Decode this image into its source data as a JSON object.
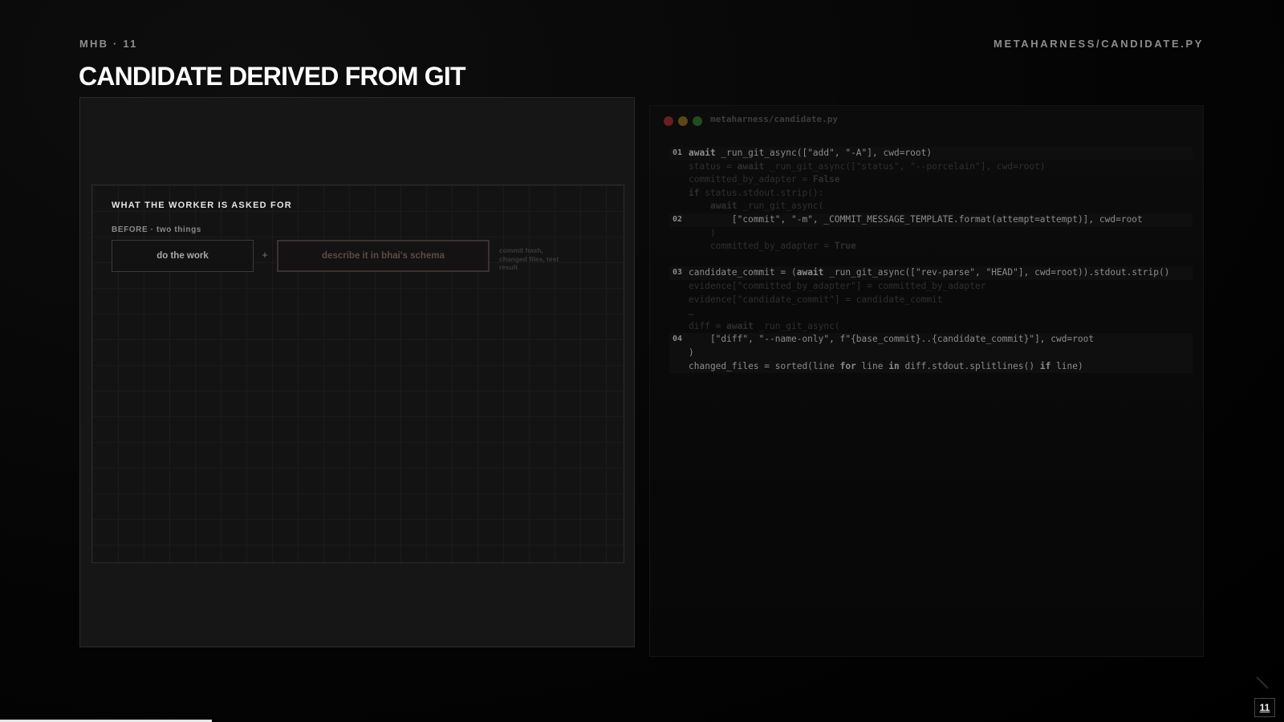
{
  "header": {
    "kicker": "MHB · 11",
    "path": "METAHARNESS/CANDIDATE.PY",
    "title": "CANDIDATE DERIVED FROM GIT"
  },
  "diagram": {
    "heading": "WHAT THE WORKER IS ASKED FOR",
    "before_label": "BEFORE · two things",
    "box_work": "do the work",
    "plus": "+",
    "box_schema": "describe it in bhai's schema",
    "side_note": "commit hash, changed files, test result"
  },
  "code_window": {
    "filename": "metaharness/candidate.py",
    "lines": [
      {
        "marker": "01",
        "text": "await _run_git_async([\"add\", \"-A\"], cwd=root)",
        "style": "bright hl"
      },
      {
        "marker": "",
        "text": "status = await _run_git_async([\"status\", \"--porcelain\"], cwd=root)",
        "style": "dim"
      },
      {
        "marker": "",
        "text": "committed_by_adapter = False",
        "style": "dim"
      },
      {
        "marker": "",
        "text": "if status.stdout.strip():",
        "style": "dim"
      },
      {
        "marker": "",
        "text": "    await _run_git_async(",
        "style": "dim"
      },
      {
        "marker": "02",
        "text": "        [\"commit\", \"-m\", _COMMIT_MESSAGE_TEMPLATE.format(attempt=attempt)], cwd=root",
        "style": "bright hl"
      },
      {
        "marker": "",
        "text": "    )",
        "style": "dim"
      },
      {
        "marker": "",
        "text": "    committed_by_adapter = True",
        "style": "dim"
      },
      {
        "marker": "",
        "text": "",
        "style": "blank"
      },
      {
        "marker": "03",
        "text": "candidate_commit = (await _run_git_async([\"rev-parse\", \"HEAD\"], cwd=root)).stdout.strip()",
        "style": "bright hl"
      },
      {
        "marker": "",
        "text": "evidence[\"committed_by_adapter\"] = committed_by_adapter",
        "style": "dim"
      },
      {
        "marker": "",
        "text": "evidence[\"candidate_commit\"] = candidate_commit",
        "style": "dim"
      },
      {
        "marker": "",
        "text": "…",
        "style": "dim"
      },
      {
        "marker": "",
        "text": "diff = await _run_git_async(",
        "style": "dim"
      },
      {
        "marker": "04",
        "text": "    [\"diff\", \"--name-only\", f\"{base_commit}..{candidate_commit}\"], cwd=root",
        "style": "bright hl"
      },
      {
        "marker": "",
        "text": ")",
        "style": "bright hl"
      },
      {
        "marker": "",
        "text": "changed_files = sorted(line for line in diff.stdout.splitlines() if line)",
        "style": "bright hl"
      }
    ]
  },
  "footer": {
    "page_number": "11",
    "progress": 0.165
  },
  "colors": {
    "background": "#000000",
    "title": "#ffffff",
    "accent_highlight": "#5c4a47",
    "traffic_red": "#6a1e1e",
    "traffic_yellow": "#5c4716",
    "traffic_green": "#1f4d20"
  }
}
